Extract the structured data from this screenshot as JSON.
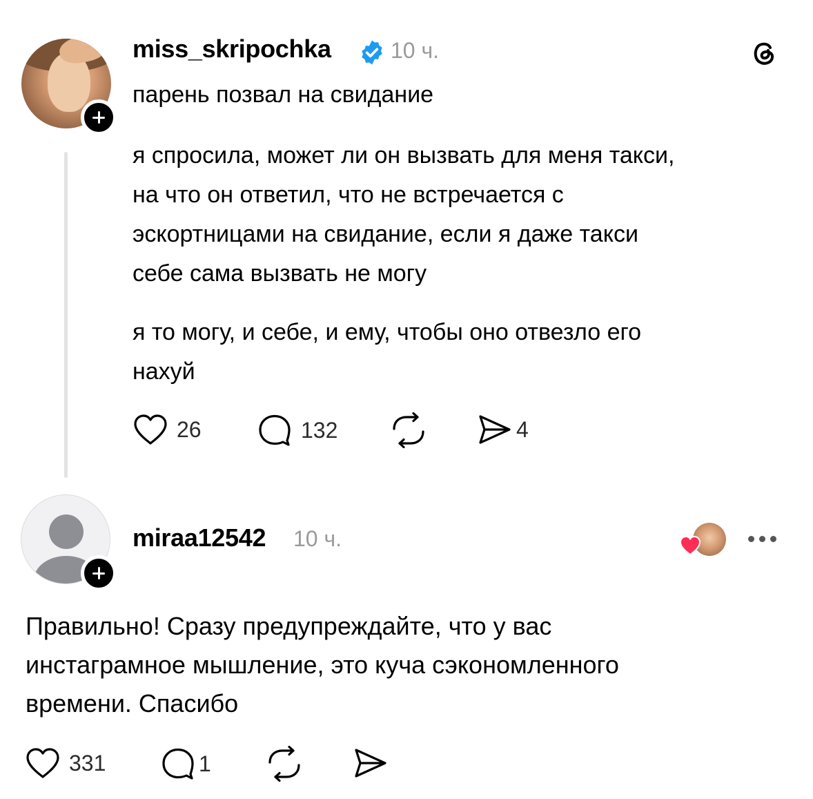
{
  "post": {
    "username": "miss_skripochka",
    "time": "10 ч.",
    "verified_icon": "verified-badge-icon",
    "app_icon": "threads-logo-icon",
    "lines": [
      "парень позвал на свидание",
      "я спросила, может ли он вызвать для меня такси,",
      "на что он ответил, что не встречается с",
      "эскортницами на свидание, если я даже такси",
      "себе сама вызвать не могу",
      "я то могу, и себе, и ему, чтобы оно отвезло его",
      "нахуй"
    ],
    "likes": "26",
    "replies": "132",
    "shares": "4"
  },
  "reply": {
    "username": "miraa12542",
    "time": "10 ч.",
    "lines": [
      "Правильно! Сразу предупреждайте, что у вас",
      "инстаграмное мышление, это куча сэкономленного",
      "времени. Спасибо"
    ],
    "likes": "331",
    "replies": "1"
  },
  "colors": {
    "verified": "#1d9bf0",
    "heart_red": "#ff2d55",
    "muted": "#9a9a9a"
  }
}
